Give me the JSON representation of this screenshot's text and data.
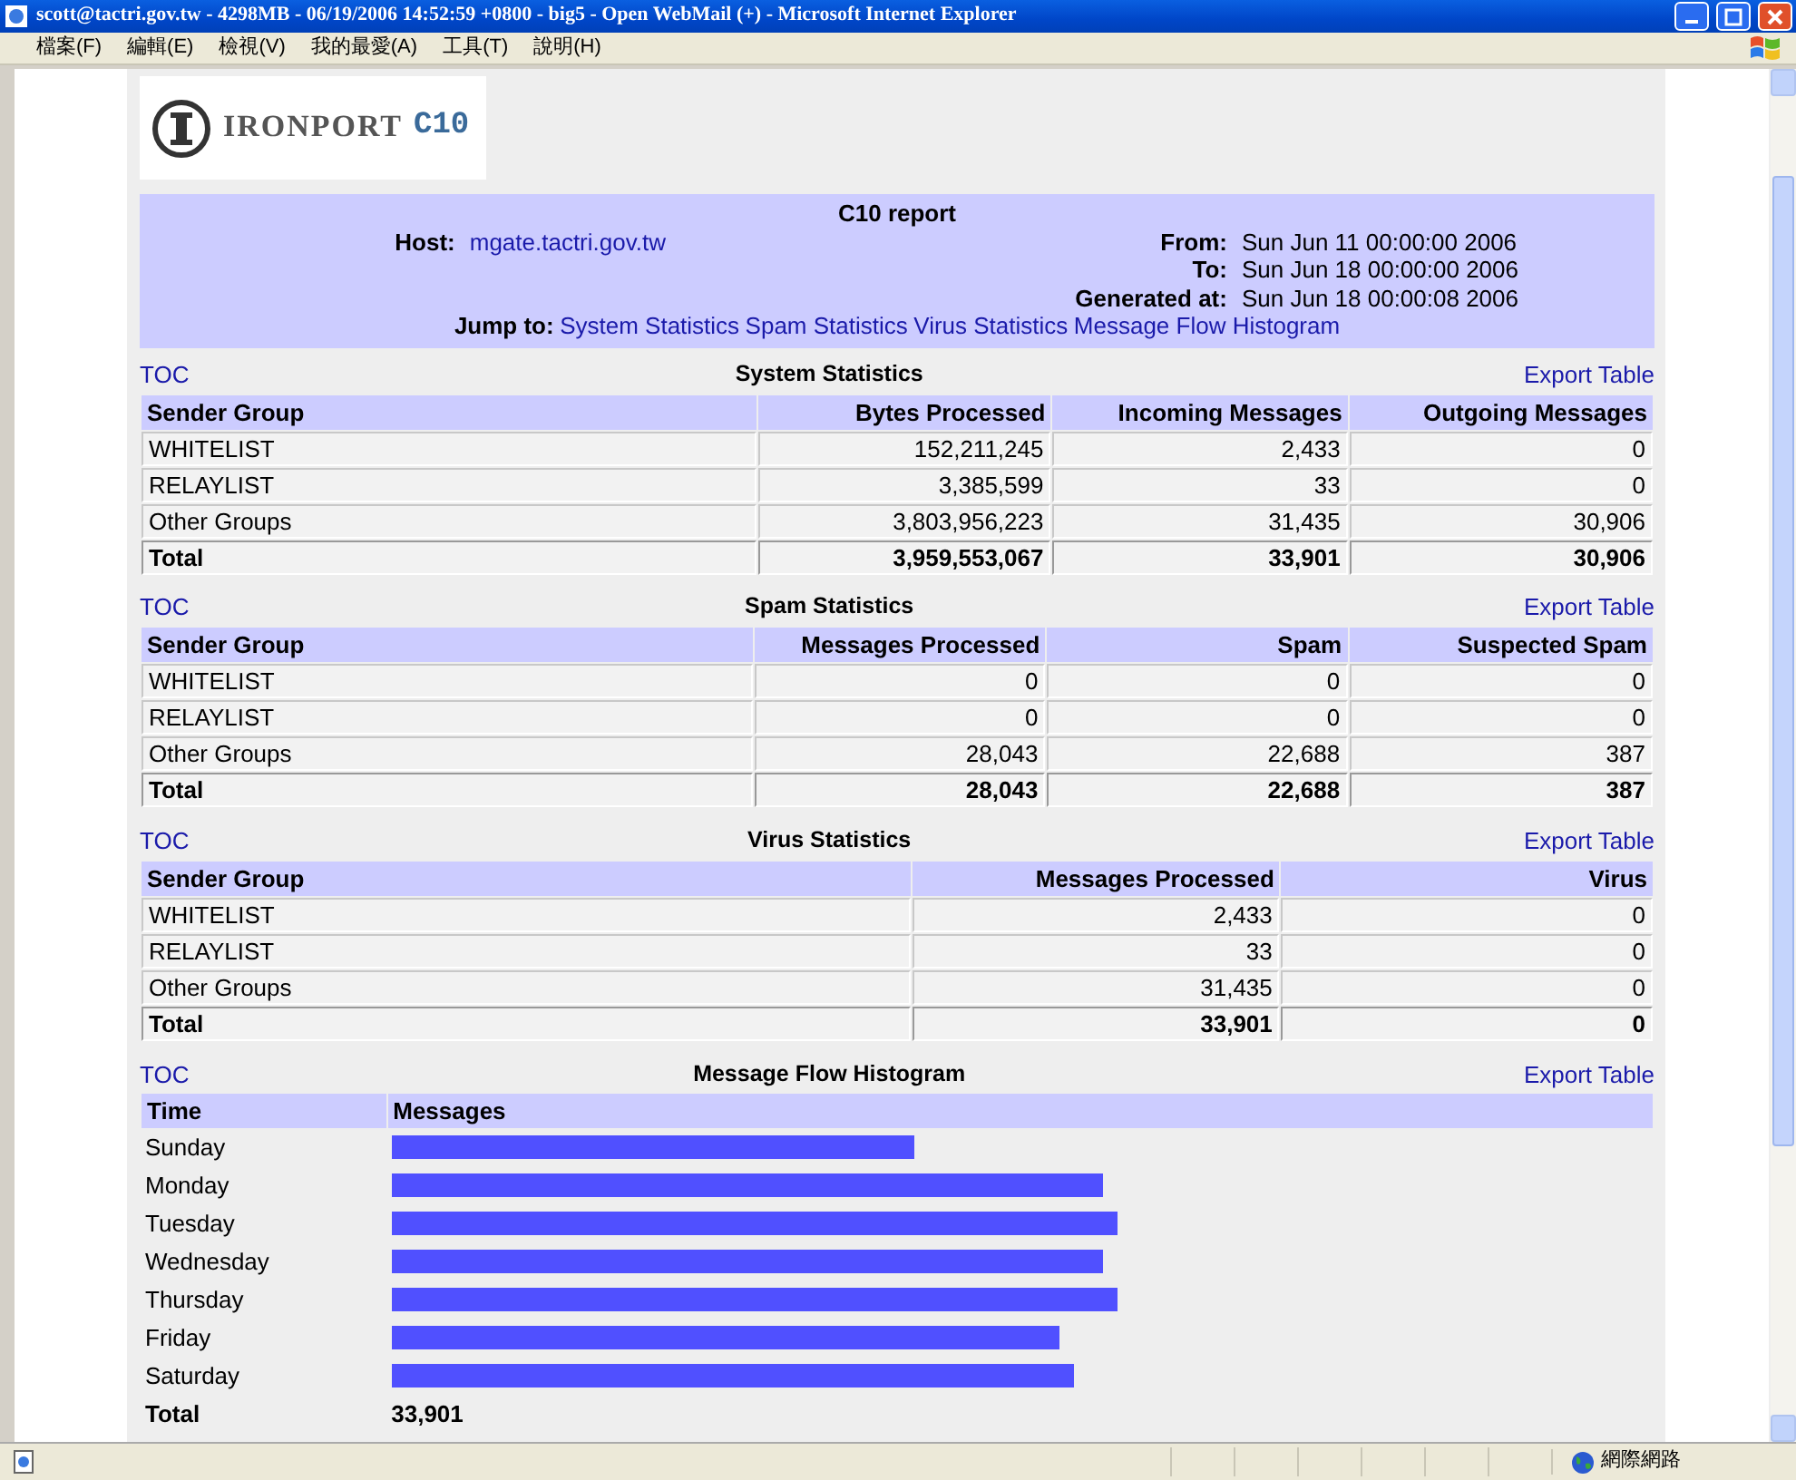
{
  "window": {
    "title": "scott@tactri.gov.tw - 4298MB - 06/19/2006 14:52:59 +0800 - big5 - Open WebMail (+) - Microsoft Internet Explorer"
  },
  "menu": [
    "檔案(F)",
    "編輯(E)",
    "檢視(V)",
    "我的最愛(A)",
    "工具(T)",
    "說明(H)"
  ],
  "logo": {
    "brand": "IRONPORT",
    "model": "C10"
  },
  "report": {
    "title": "C10 report",
    "host_label": "Host:",
    "host": "mgate.tactri.gov.tw",
    "from_label": "From:",
    "from": "Sun Jun 11 00:00:00 2006",
    "to_label": "To:",
    "to": "Sun Jun 18 00:00:00 2006",
    "generated_label": "Generated at:",
    "generated": "Sun Jun 18 00:00:08 2006",
    "jump_label": "Jump to:",
    "jump_links": [
      "System Statistics",
      "Spam Statistics",
      "Virus Statistics",
      "Message Flow Histogram"
    ]
  },
  "sections": [
    {
      "toc": "TOC",
      "title": "System Statistics",
      "export": "Export Table",
      "columns": [
        "Sender Group",
        "Bytes Processed",
        "Incoming Messages",
        "Outgoing Messages"
      ],
      "rows": [
        [
          "WHITELIST",
          "152,211,245",
          "2,433",
          "0"
        ],
        [
          "RELAYLIST",
          "3,385,599",
          "33",
          "0"
        ],
        [
          "Other Groups",
          "3,803,956,223",
          "31,435",
          "30,906"
        ]
      ],
      "total": [
        "Total",
        "3,959,553,067",
        "33,901",
        "30,906"
      ]
    },
    {
      "toc": "TOC",
      "title": "Spam Statistics",
      "export": "Export Table",
      "columns": [
        "Sender Group",
        "Messages Processed",
        "Spam",
        "Suspected Spam"
      ],
      "rows": [
        [
          "WHITELIST",
          "0",
          "0",
          "0"
        ],
        [
          "RELAYLIST",
          "0",
          "0",
          "0"
        ],
        [
          "Other Groups",
          "28,043",
          "22,688",
          "387"
        ]
      ],
      "total": [
        "Total",
        "28,043",
        "22,688",
        "387"
      ]
    },
    {
      "toc": "TOC",
      "title": "Virus Statistics",
      "export": "Export Table",
      "columns": [
        "Sender Group",
        "Messages Processed",
        "Virus"
      ],
      "rows": [
        [
          "WHITELIST",
          "2,433",
          "0"
        ],
        [
          "RELAYLIST",
          "33",
          "0"
        ],
        [
          "Other Groups",
          "31,435",
          "0"
        ]
      ],
      "total": [
        "Total",
        "33,901",
        "0"
      ]
    }
  ],
  "histogram": {
    "toc": "TOC",
    "title": "Message Flow Histogram",
    "export": "Export Table",
    "columns": [
      "Time",
      "Messages"
    ],
    "rows": [
      {
        "label": "Sunday"
      },
      {
        "label": "Monday"
      },
      {
        "label": "Tuesday"
      },
      {
        "label": "Wednesday"
      },
      {
        "label": "Thursday"
      },
      {
        "label": "Friday"
      },
      {
        "label": "Saturday"
      }
    ],
    "total": [
      "Total",
      "33,901"
    ]
  },
  "status_bar": {
    "zone": "網際網路"
  }
}
